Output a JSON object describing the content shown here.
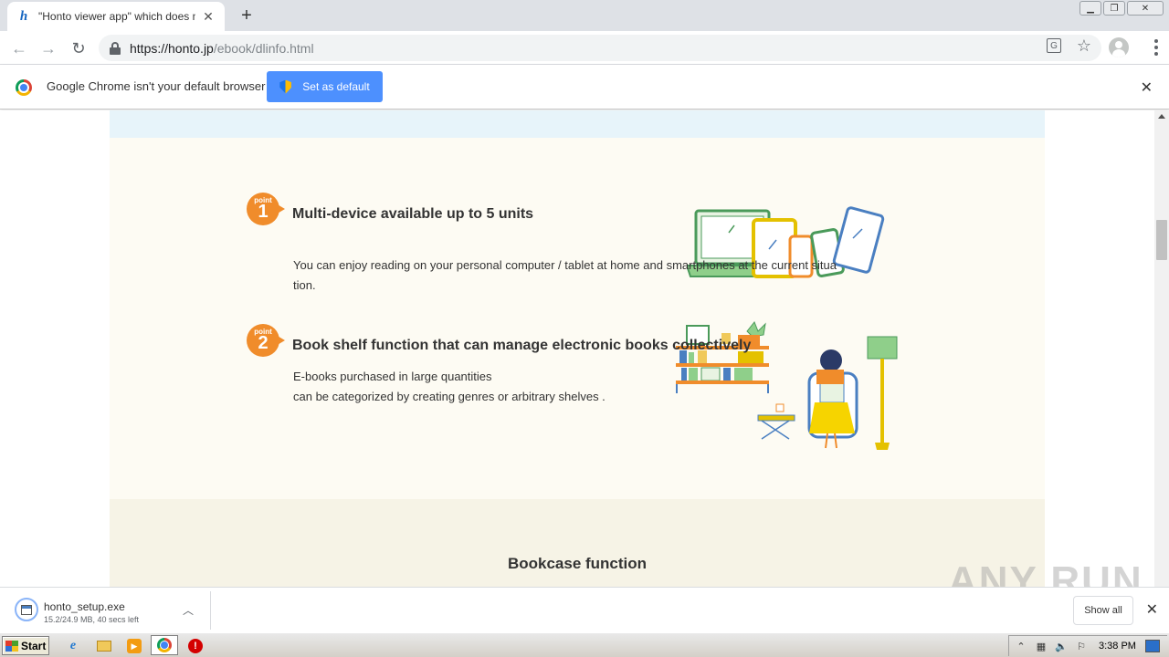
{
  "browser": {
    "tab_title": "\"Honto viewer app\" which does not r",
    "favicon_letter": "h",
    "url_host": "https://honto.jp",
    "url_path": "/ebook/dlinfo.html"
  },
  "infobar": {
    "message": "Google Chrome isn't your default browser",
    "button_label": "Set as default"
  },
  "page": {
    "point_word": "point",
    "feature1": {
      "number": "1",
      "title": "Multi-device available up to 5 units",
      "desc_line1": "You can enjoy reading on your personal computer / tablet at home and smartphones at the current situa",
      "desc_line2": "tion."
    },
    "feature2": {
      "number": "2",
      "title": "Book shelf function that can manage electronic books collectively",
      "desc_line1": "E-books purchased in large quantities",
      "desc_line2": "can be categorized by creating genres or arbitrary shelves ."
    },
    "section_title": "Bookcase function"
  },
  "downloads": {
    "file_name": "honto_setup.exe",
    "status": "15.2/24.9 MB, 40 secs left",
    "show_all_label": "Show all"
  },
  "watermark": "ANY RUN",
  "taskbar": {
    "start_label": "Start",
    "clock": "3:38 PM"
  },
  "colors": {
    "accent_orange": "#f08c2b",
    "infobar_button": "#4d90fe",
    "panel_bg": "#fdfbf3",
    "band_blue": "#e7f4fa"
  }
}
